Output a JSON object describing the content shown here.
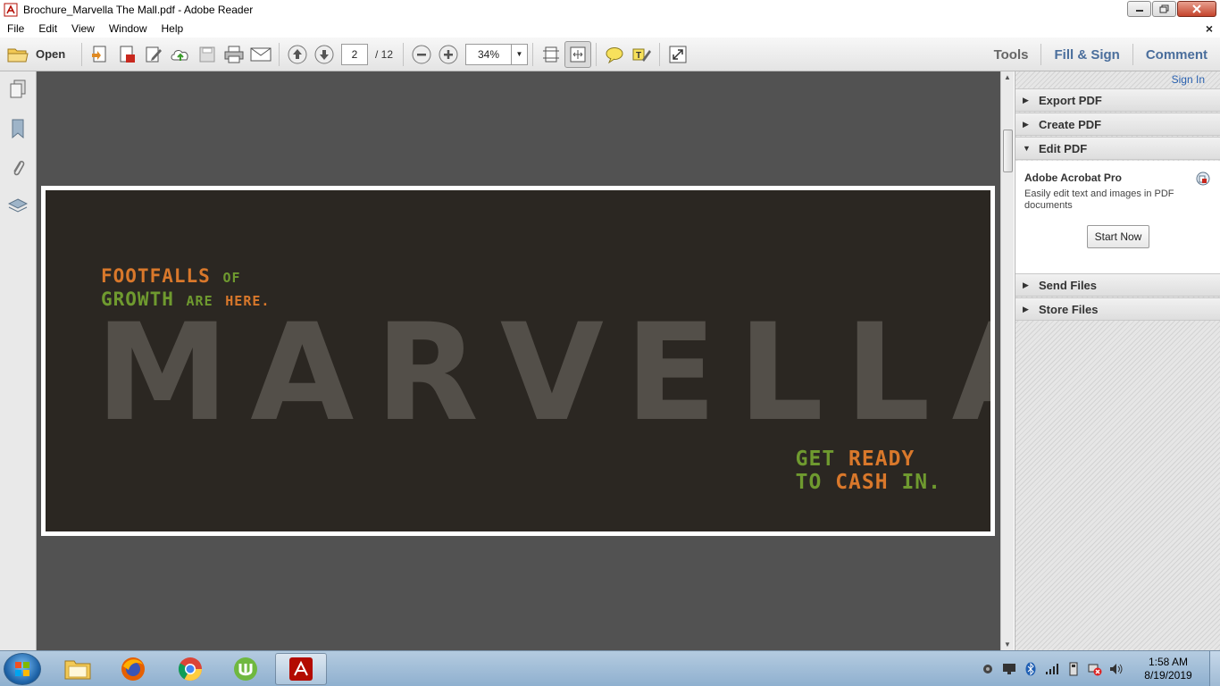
{
  "window": {
    "title": "Brochure_Marvella The Mall.pdf - Adobe Reader"
  },
  "menu": {
    "items": [
      "File",
      "Edit",
      "View",
      "Window",
      "Help"
    ],
    "close_doc": "×"
  },
  "toolbar": {
    "open_label": "Open",
    "page_current": "2",
    "page_total": "/ 12",
    "zoom": "34%",
    "tools_label": "Tools",
    "fill_sign_label": "Fill & Sign",
    "comment_label": "Comment"
  },
  "document": {
    "tagline_top": {
      "line1_a": "FOOTFALLS",
      "line1_b": "OF",
      "line2_a": "GROWTH",
      "line2_b": "ARE",
      "line2_c": "HERE."
    },
    "big_word": "MARVELLA",
    "tagline_bottom": {
      "line1_a": "GET",
      "line1_b": "READY",
      "line2_a": "TO",
      "line2_b": "CASH",
      "line2_c": "IN."
    }
  },
  "right_pane": {
    "sign_in": "Sign In",
    "panels": {
      "export": "Export PDF",
      "create": "Create PDF",
      "edit": "Edit PDF",
      "send": "Send Files",
      "store": "Store Files"
    },
    "edit_body": {
      "title": "Adobe Acrobat Pro",
      "description": "Easily edit text and images in PDF documents",
      "button": "Start Now"
    }
  },
  "taskbar": {
    "time": "1:58 AM",
    "date": "8/19/2019"
  },
  "colors": {
    "accent_blue": "#4a6e9c",
    "brochure_bg": "#2b2722",
    "brochure_orange": "#d9782b",
    "brochure_green": "#6f9a2f"
  }
}
